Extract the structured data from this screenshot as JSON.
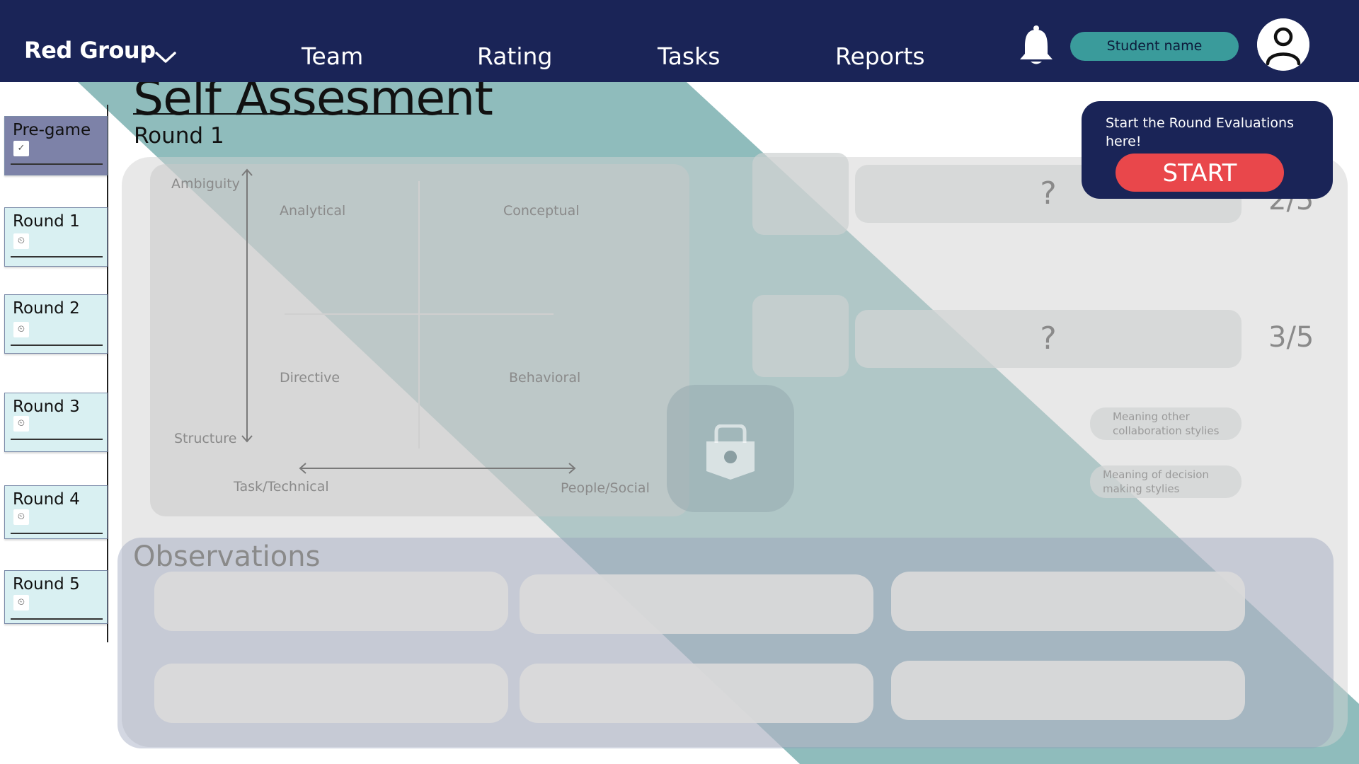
{
  "header": {
    "group_name": "Red Group",
    "nav": [
      "Team",
      "Rating",
      "Tasks",
      "Reports"
    ],
    "student_name": "Student name"
  },
  "page": {
    "title": "Self Assesment",
    "subtitle": "Round 1"
  },
  "sidebar": {
    "items": [
      {
        "label": "Pre-game",
        "state": "completed"
      },
      {
        "label": "Round 1",
        "state": "locked"
      },
      {
        "label": "Round 2",
        "state": "locked"
      },
      {
        "label": "Round 3",
        "state": "locked"
      },
      {
        "label": "Round 4",
        "state": "locked"
      },
      {
        "label": "Round 5",
        "state": "locked"
      }
    ]
  },
  "quadrant": {
    "y_top": "Ambiguity",
    "y_bottom": "Structure",
    "x_left": "Task/Technical",
    "x_right": "People/Social",
    "cells": [
      "Analytical",
      "Conceptual",
      "Directive",
      "Behavioral"
    ]
  },
  "results": {
    "rows": [
      {
        "value": "?",
        "score": "2/5"
      },
      {
        "value": "?",
        "score": "3/5"
      }
    ],
    "pills": [
      "Meaning other collaboration stylies",
      "Meaning of decision making stylies"
    ]
  },
  "popup": {
    "text": "Start the Round Evaluations here!",
    "button": "START"
  },
  "observations": {
    "title": "Observations"
  },
  "colors": {
    "header_bg": "#1a2457",
    "accent_teal": "#3a9b9b",
    "start_red": "#e9474b",
    "sidebar_item": "#d9f0f2",
    "sidebar_done": "#7d82a8"
  },
  "icons": [
    "chevron-down-icon",
    "bell-icon",
    "user-avatar-icon",
    "checkmark-icon",
    "lock-icon",
    "padlock-icon"
  ]
}
